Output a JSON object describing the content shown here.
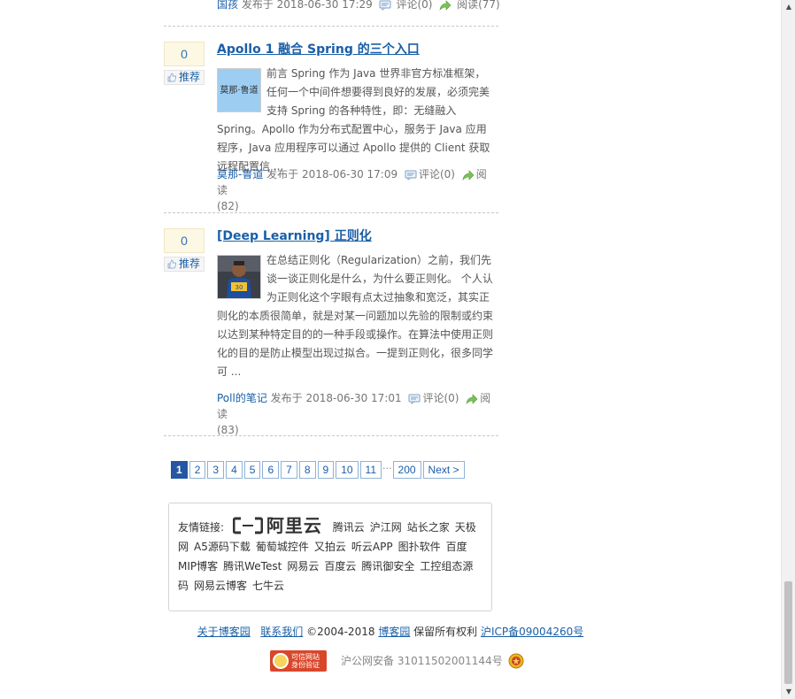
{
  "prev_post": {
    "author": "国孩",
    "published": "发布于 2018-06-30 17:29",
    "comments": "评论(0)",
    "views": "阅读(77)"
  },
  "posts": [
    {
      "digg_count": "0",
      "digg_label": "推荐",
      "title": "Apollo 1 融合 Spring 的三个入口",
      "avatar_text": "莫那·鲁道",
      "summary": "前言 Spring 作为 Java 世界非官方标准框架，任何一个中间件想要得到良好的发展，必须完美支持 Spring 的各种特性，即：无缝融入 Spring。Apollo 作为分布式配置中心，服务于 Java 应用程序，Java 应用程序可以通过 Apollo 提供的 Client 获取远程配置信 ...",
      "author": "莫那-鲁道",
      "published": "发布于 2018-06-30 17:09",
      "comments": "评论(0)",
      "views_label": "阅读",
      "views_count": "(82)"
    },
    {
      "digg_count": "0",
      "digg_label": "推荐",
      "title": "[Deep Learning] 正则化",
      "summary": "在总结正则化（Regularization）之前，我们先谈一谈正则化是什么，为什么要正则化。 个人认为正则化这个字眼有点太过抽象和宽泛，其实正则化的本质很简单，就是对某一问题加以先验的限制或约束以达到某种特定目的的一种手段或操作。在算法中使用正则化的目的是防止模型出现过拟合。一提到正则化，很多同学可 ...",
      "author": "Poll的笔记",
      "published": "发布于 2018-06-30 17:01",
      "comments": "评论(0)",
      "views_label": "阅读",
      "views_count": "(83)"
    }
  ],
  "pager": {
    "current": "1",
    "pages": [
      "2",
      "3",
      "4",
      "5",
      "6",
      "7",
      "8",
      "9",
      "10",
      "11"
    ],
    "ellipsis": "···",
    "last": "200",
    "next": "Next >"
  },
  "friend_links": {
    "label": "友情链接:",
    "aliyun_text": "阿里云",
    "items": [
      "腾讯云",
      "沪江网",
      "站长之家",
      "天极网",
      "A5源码下载",
      "葡萄城控件",
      "又拍云",
      "听云APP",
      "图扑软件",
      "百度MIP博客",
      "腾讯WeTest",
      "网易云",
      "百度云",
      "腾讯御安全",
      "工控组态源码",
      "网易云博客",
      "七牛云"
    ]
  },
  "footer": {
    "about": "关于博客园",
    "contact": "联系我们",
    "copyright": "©2004-2018",
    "site": "博客园",
    "rights": "保留所有权利",
    "icp": "沪ICP备09004260号",
    "badge_line1": "可信网站",
    "badge_line2": "身份验证",
    "police": "沪公网安备 31011502001144号"
  },
  "colors": {
    "link": "#1a5fa8",
    "pager_current": "#2456a3",
    "digg_bg": "#fcf8e3"
  }
}
